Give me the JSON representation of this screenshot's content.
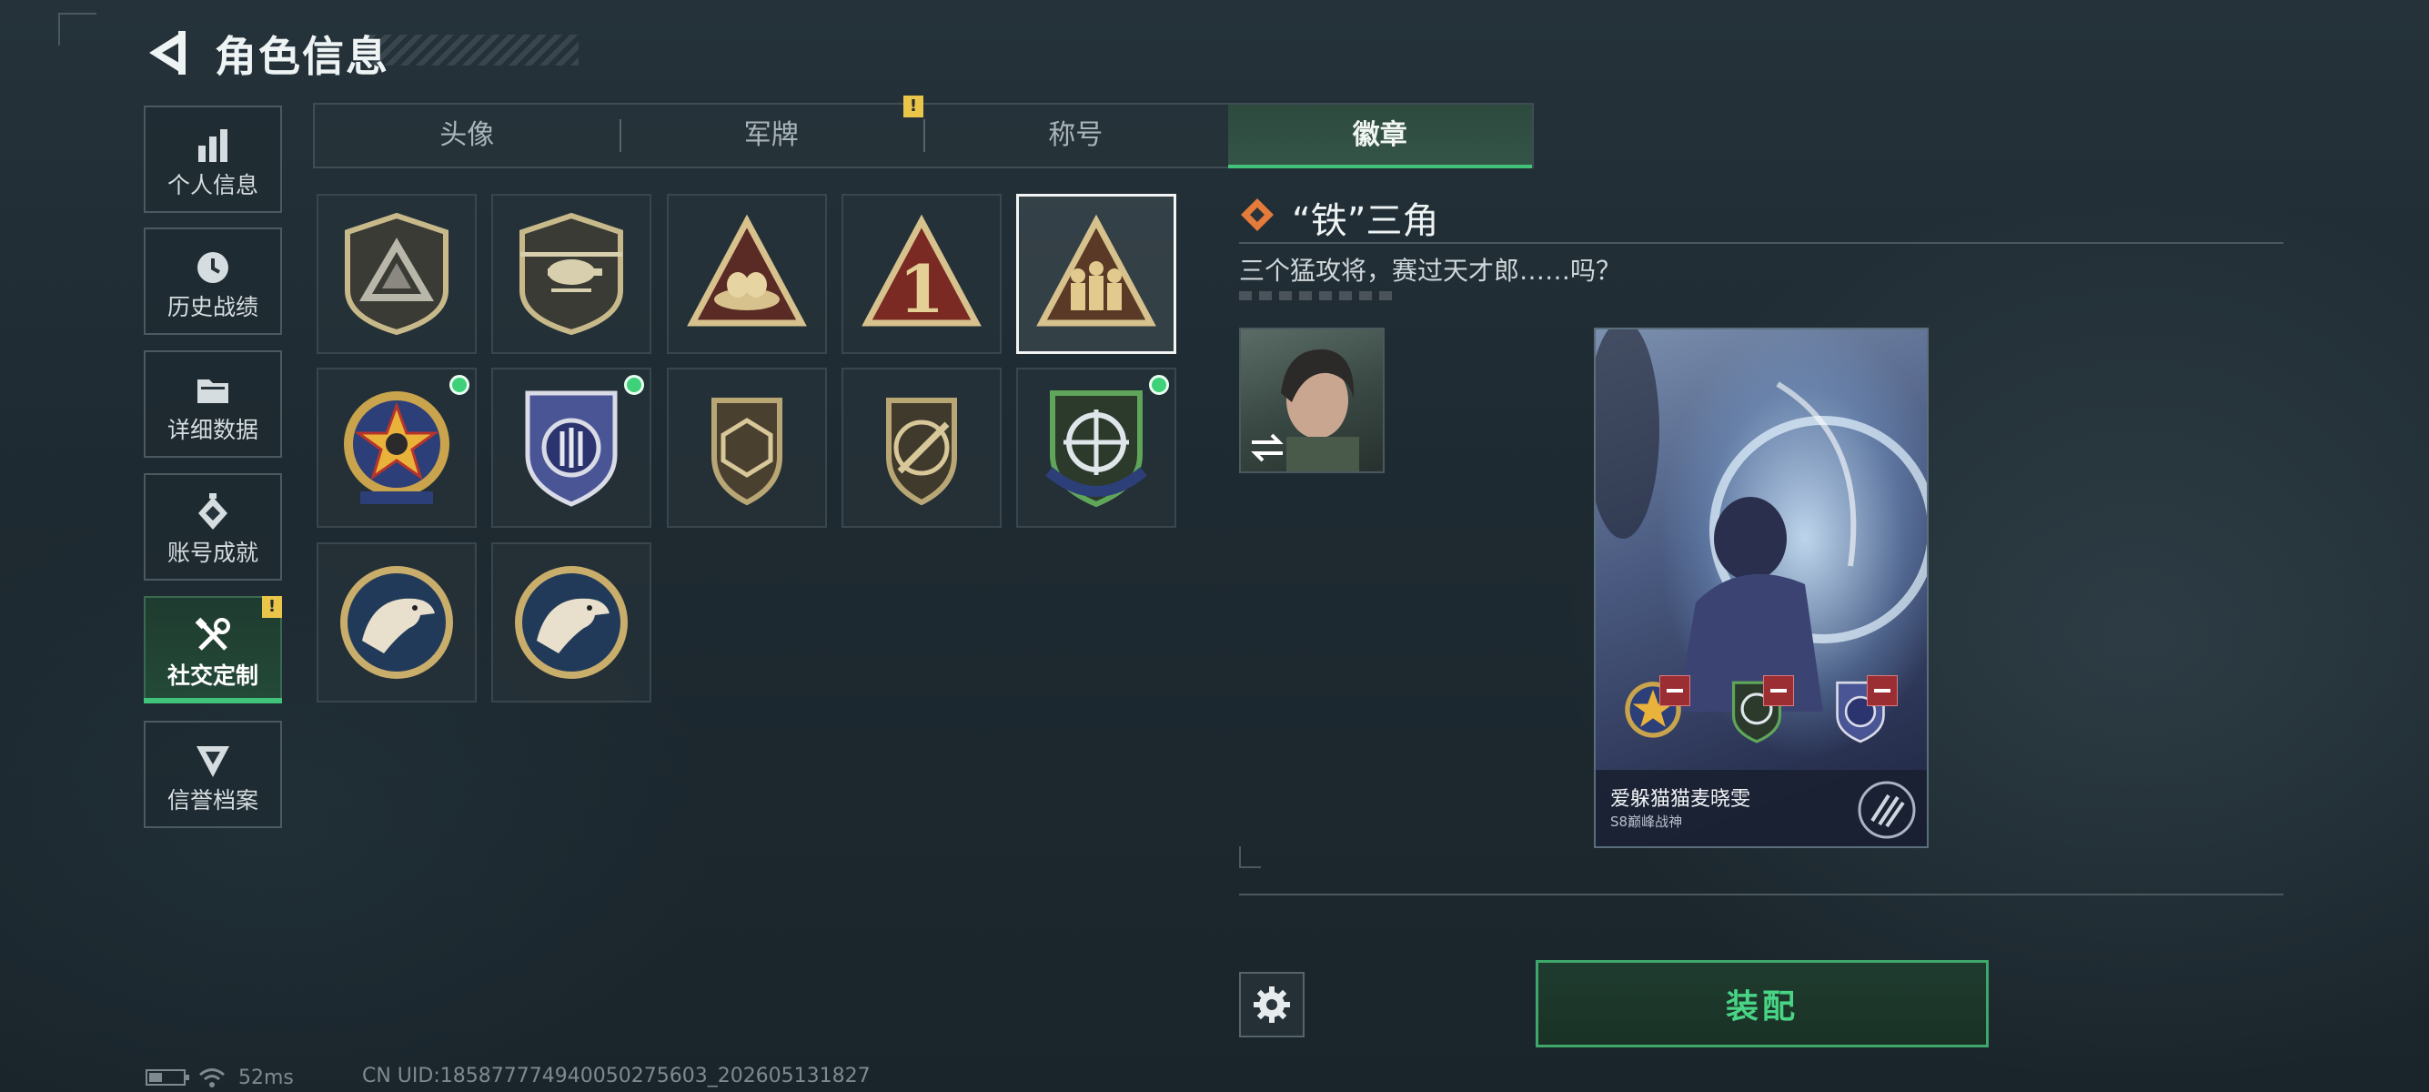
{
  "header": {
    "title": "角色信息"
  },
  "sidebar": {
    "items": [
      {
        "label": "个人信息",
        "icon": "bar-chart-icon",
        "active": false
      },
      {
        "label": "历史战绩",
        "icon": "clock-icon",
        "active": false
      },
      {
        "label": "详细数据",
        "icon": "folder-icon",
        "active": false
      },
      {
        "label": "账号成就",
        "icon": "achievement-icon",
        "active": false
      },
      {
        "label": "社交定制",
        "icon": "tools-icon",
        "active": true,
        "alert": "!"
      },
      {
        "label": "信誉档案",
        "icon": "credit-icon",
        "active": false
      }
    ]
  },
  "tabs": [
    {
      "label": "头像",
      "active": false
    },
    {
      "label": "军牌",
      "active": false,
      "alert": "!"
    },
    {
      "label": "称号",
      "active": false
    },
    {
      "label": "徽章",
      "active": true
    }
  ],
  "badges": [
    {
      "icon": "triangle-shield-badge-icon",
      "selected": false,
      "new": false
    },
    {
      "icon": "helicopter-shield-badge-icon",
      "selected": false,
      "new": false
    },
    {
      "icon": "nest-triangle-badge-icon",
      "selected": false,
      "new": false
    },
    {
      "icon": "number-one-triangle-badge-icon",
      "selected": false,
      "new": false
    },
    {
      "icon": "iron-triangle-soldiers-badge-icon",
      "selected": true,
      "new": false
    },
    {
      "icon": "star-round-badge-icon",
      "selected": false,
      "new": true
    },
    {
      "icon": "wing-shield-badge-icon",
      "selected": false,
      "new": true
    },
    {
      "icon": "hexagon-shield-badge-icon",
      "selected": false,
      "new": false
    },
    {
      "icon": "rifle-shield-badge-icon",
      "selected": false,
      "new": false
    },
    {
      "icon": "crosshair-shield-badge-icon",
      "selected": false,
      "new": true
    },
    {
      "icon": "eagle-round-badge-icon",
      "selected": false,
      "new": false
    },
    {
      "icon": "eagle-round-badge-icon",
      "selected": false,
      "new": false
    }
  ],
  "detail": {
    "name": "“铁”三角",
    "description": "三个猛攻将，赛过天才郎……吗？",
    "card": {
      "player_name": "爱躲猫猫麦晓雯",
      "rank": "S8巅峰战神"
    },
    "equip_label": "装配"
  },
  "status_bar": {
    "ping": "52ms",
    "uid": "CN UID:185877774940050275603_202605131827"
  },
  "colors": {
    "accent_green": "#41c479",
    "new_dot": "#3fd07a",
    "alert_yellow": "#e9c64a",
    "remove_red": "#9b2e33"
  }
}
